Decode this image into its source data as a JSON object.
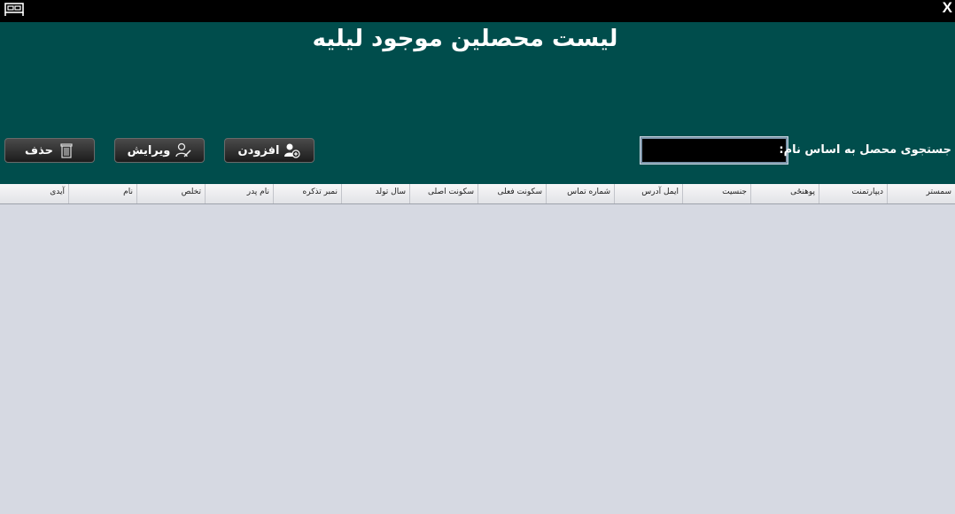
{
  "window": {
    "close_label": "X",
    "app_icon": "bed-icon"
  },
  "header": {
    "title": "لیست محصلین موجود لیلیه"
  },
  "toolbar": {
    "delete_label": "حذف",
    "edit_label": "ویرایش",
    "add_label": "افزودن",
    "delete_icon": "trash-icon",
    "edit_icon": "user-edit-icon",
    "add_icon": "user-add-icon"
  },
  "search": {
    "label": "جستجوی محصل به اساس نام:",
    "value": ""
  },
  "table": {
    "columns": [
      "سمستر",
      "دیپارتمنت",
      "پوهنځی",
      "جنسیت",
      "ایمل آدرس",
      "شماره تماس",
      "سکونت فعلی",
      "سکونت اصلی",
      "سال تولد",
      "نمبر تذکره",
      "نام پدر",
      "تخلص",
      "نام",
      "آیدی"
    ],
    "rows": []
  },
  "colors": {
    "titlebar": "#000000",
    "header_bg": "#004d4c",
    "body_bg": "#d6d9e2"
  }
}
